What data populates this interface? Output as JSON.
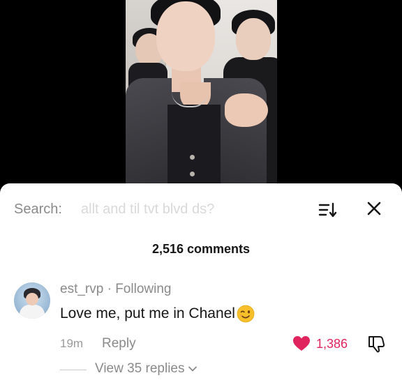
{
  "search": {
    "label": "Search:",
    "query": "allt and til tvt blvd ds?"
  },
  "comments": {
    "count_label": "2,516 comments"
  },
  "comment": {
    "username": "est_rvp",
    "separator": "·",
    "follow_status": "Following",
    "text": "Love me, put me in Chanel",
    "emoji": "winking-face",
    "time": "19m",
    "reply_label": "Reply",
    "likes": "1,386",
    "replies_label": "View 35 replies"
  },
  "colors": {
    "like_red": "#e0245e",
    "muted_text": "#8a8a8a",
    "text": "#161616"
  }
}
